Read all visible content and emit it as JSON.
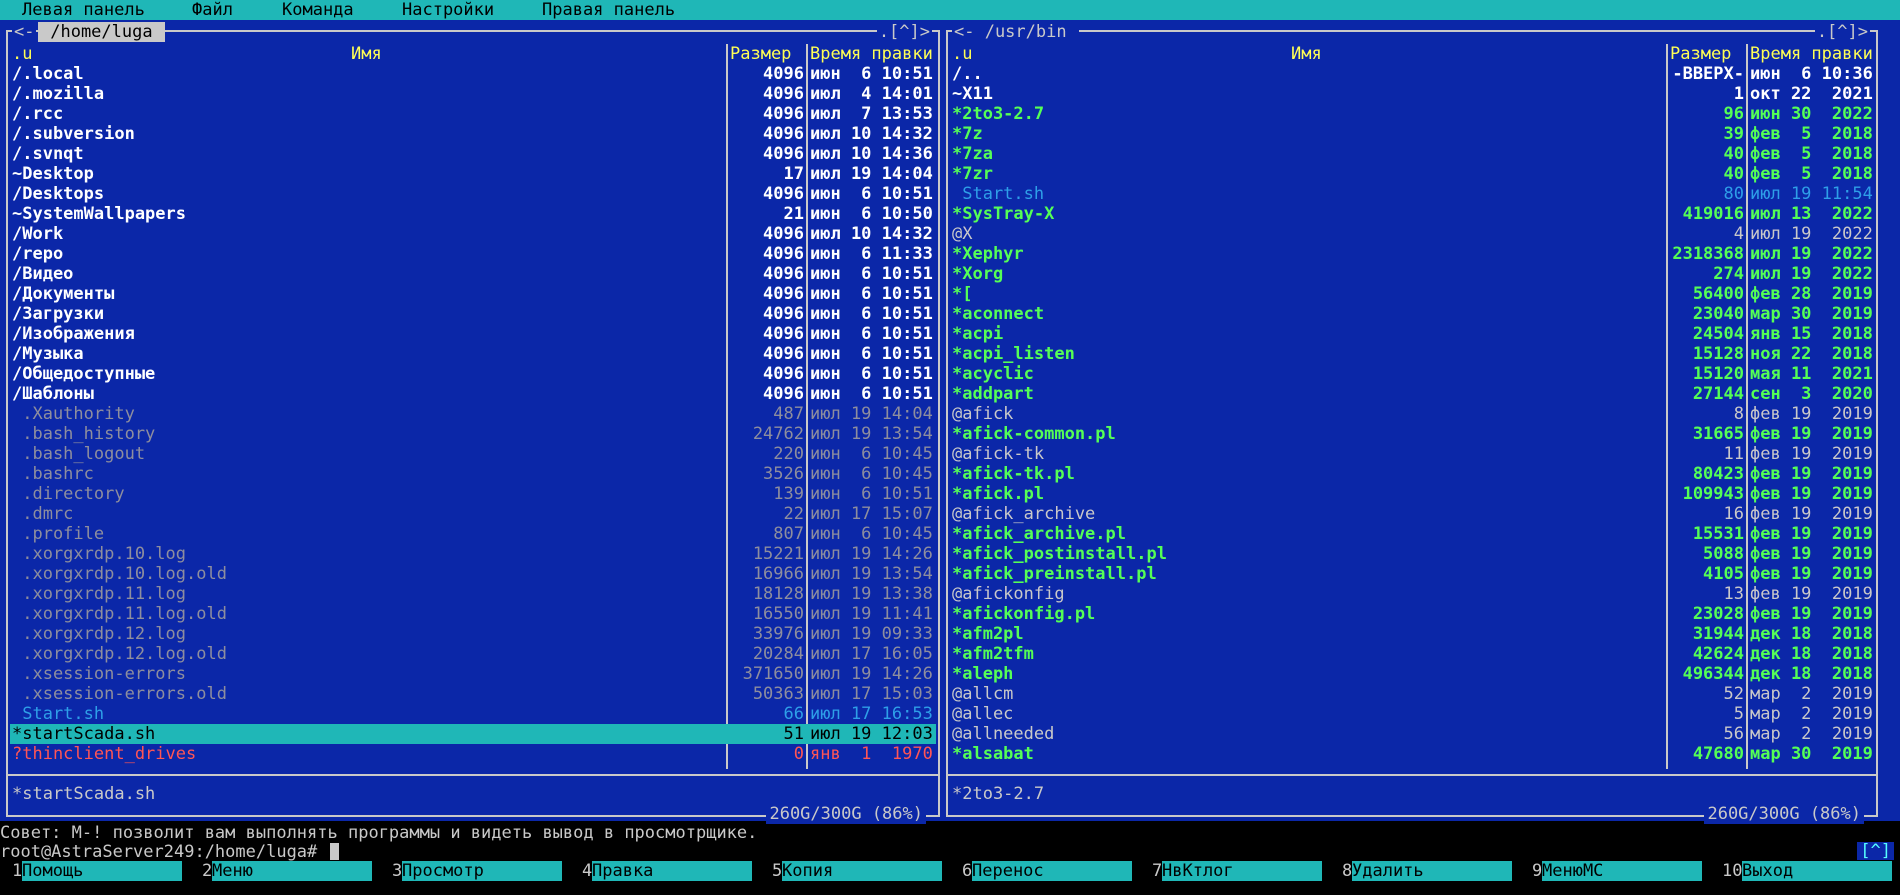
{
  "menu": [
    "Левая панель",
    "Файл",
    "Команда",
    "Настройки",
    "Правая панель"
  ],
  "colors": {
    "dir": "#ffffff",
    "hidden": "#8e8e9e",
    "exec": "#55ff55",
    "link": "#c9c9c9",
    "stalelink": "#ff5555",
    "script": "#2e9fe8",
    "selected_bg": "#1fb7b7",
    "selected_fg": "#000000"
  },
  "left": {
    "path": " /home/luga ",
    "corner": ".[^]>",
    "headers": {
      "sort": ".u",
      "name": "Имя",
      "size": "Размер",
      "time": "Время правки"
    },
    "rows": [
      {
        "name": "/.local",
        "size": "4096",
        "time": "июн  6 10:51",
        "kind": "dir"
      },
      {
        "name": "/.mozilla",
        "size": "4096",
        "time": "июл  4 14:01",
        "kind": "dir"
      },
      {
        "name": "/.rcc",
        "size": "4096",
        "time": "июл  7 13:53",
        "kind": "dir"
      },
      {
        "name": "/.subversion",
        "size": "4096",
        "time": "июл 10 14:32",
        "kind": "dir"
      },
      {
        "name": "/.svnqt",
        "size": "4096",
        "time": "июл 10 14:36",
        "kind": "dir"
      },
      {
        "name": "~Desktop",
        "size": "17",
        "time": "июл 19 14:04",
        "kind": "dir"
      },
      {
        "name": "/Desktops",
        "size": "4096",
        "time": "июн  6 10:51",
        "kind": "dir"
      },
      {
        "name": "~SystemWallpapers",
        "size": "21",
        "time": "июн  6 10:50",
        "kind": "dir"
      },
      {
        "name": "/Work",
        "size": "4096",
        "time": "июл 10 14:32",
        "kind": "dir"
      },
      {
        "name": "/repo",
        "size": "4096",
        "time": "июн  6 11:33",
        "kind": "dir"
      },
      {
        "name": "/Видео",
        "size": "4096",
        "time": "июн  6 10:51",
        "kind": "dir"
      },
      {
        "name": "/Документы",
        "size": "4096",
        "time": "июн  6 10:51",
        "kind": "dir"
      },
      {
        "name": "/Загрузки",
        "size": "4096",
        "time": "июн  6 10:51",
        "kind": "dir"
      },
      {
        "name": "/Изображения",
        "size": "4096",
        "time": "июн  6 10:51",
        "kind": "dir"
      },
      {
        "name": "/Музыка",
        "size": "4096",
        "time": "июн  6 10:51",
        "kind": "dir"
      },
      {
        "name": "/Общедоступные",
        "size": "4096",
        "time": "июн  6 10:51",
        "kind": "dir"
      },
      {
        "name": "/Шаблоны",
        "size": "4096",
        "time": "июн  6 10:51",
        "kind": "dir"
      },
      {
        "name": " .Xauthority",
        "size": "487",
        "time": "июл 19 14:04",
        "kind": "hidden"
      },
      {
        "name": " .bash_history",
        "size": "24762",
        "time": "июл 19 13:54",
        "kind": "hidden"
      },
      {
        "name": " .bash_logout",
        "size": "220",
        "time": "июн  6 10:45",
        "kind": "hidden"
      },
      {
        "name": " .bashrc",
        "size": "3526",
        "time": "июн  6 10:45",
        "kind": "hidden"
      },
      {
        "name": " .directory",
        "size": "139",
        "time": "июн  6 10:51",
        "kind": "hidden"
      },
      {
        "name": " .dmrc",
        "size": "22",
        "time": "июл 17 15:07",
        "kind": "hidden"
      },
      {
        "name": " .profile",
        "size": "807",
        "time": "июн  6 10:45",
        "kind": "hidden"
      },
      {
        "name": " .xorgxrdp.10.log",
        "size": "15221",
        "time": "июл 19 14:26",
        "kind": "hidden"
      },
      {
        "name": " .xorgxrdp.10.log.old",
        "size": "16966",
        "time": "июл 19 13:54",
        "kind": "hidden"
      },
      {
        "name": " .xorgxrdp.11.log",
        "size": "18128",
        "time": "июл 19 13:38",
        "kind": "hidden"
      },
      {
        "name": " .xorgxrdp.11.log.old",
        "size": "16550",
        "time": "июл 19 11:41",
        "kind": "hidden"
      },
      {
        "name": " .xorgxrdp.12.log",
        "size": "33976",
        "time": "июл 19 09:33",
        "kind": "hidden"
      },
      {
        "name": " .xorgxrdp.12.log.old",
        "size": "20284",
        "time": "июл 17 16:05",
        "kind": "hidden"
      },
      {
        "name": " .xsession-errors",
        "size": "371650",
        "time": "июл 19 14:26",
        "kind": "hidden"
      },
      {
        "name": " .xsession-errors.old",
        "size": "50363",
        "time": "июл 17 15:03",
        "kind": "hidden"
      },
      {
        "name": " Start.sh",
        "size": "66",
        "time": "июл 17 16:53",
        "kind": "script"
      },
      {
        "name": "*startScada.sh",
        "size": "51",
        "time": "июл 19 12:03",
        "kind": "selected"
      },
      {
        "name": "?thinclient_drives",
        "size": "0",
        "time": "янв  1  1970",
        "kind": "stalelink"
      }
    ],
    "status": "*startScada.sh",
    "disk": "260G/300G (86%)"
  },
  "right": {
    "path": "<- /usr/bin ",
    "corner": ".[^]>",
    "headers": {
      "sort": ".u",
      "name": "Имя",
      "size": "Размер",
      "time": "Время правки"
    },
    "rows": [
      {
        "name": "/..",
        "size": "-ВВЕРХ-",
        "time": "июн  6 10:36",
        "kind": "dir"
      },
      {
        "name": "~X11",
        "size": "1",
        "time": "окт 22  2021",
        "kind": "dir"
      },
      {
        "name": "*2to3-2.7",
        "size": "96",
        "time": "июн 30  2022",
        "kind": "exec"
      },
      {
        "name": "*7z",
        "size": "39",
        "time": "фев  5  2018",
        "kind": "exec"
      },
      {
        "name": "*7za",
        "size": "40",
        "time": "фев  5  2018",
        "kind": "exec"
      },
      {
        "name": "*7zr",
        "size": "40",
        "time": "фев  5  2018",
        "kind": "exec"
      },
      {
        "name": " Start.sh",
        "size": "80",
        "time": "июл 19 11:54",
        "kind": "script"
      },
      {
        "name": "*SysTray-X",
        "size": "419016",
        "time": "июл 13  2022",
        "kind": "exec"
      },
      {
        "name": "@X",
        "size": "4",
        "time": "июл 19  2022",
        "kind": "link"
      },
      {
        "name": "*Xephyr",
        "size": "2318368",
        "time": "июл 19  2022",
        "kind": "exec"
      },
      {
        "name": "*Xorg",
        "size": "274",
        "time": "июл 19  2022",
        "kind": "exec"
      },
      {
        "name": "*[",
        "size": "56400",
        "time": "фев 28  2019",
        "kind": "exec"
      },
      {
        "name": "*aconnect",
        "size": "23040",
        "time": "мар 30  2019",
        "kind": "exec"
      },
      {
        "name": "*acpi",
        "size": "24504",
        "time": "янв 15  2018",
        "kind": "exec"
      },
      {
        "name": "*acpi_listen",
        "size": "15128",
        "time": "ноя 22  2018",
        "kind": "exec"
      },
      {
        "name": "*acyclic",
        "size": "15120",
        "time": "мая 11  2021",
        "kind": "exec"
      },
      {
        "name": "*addpart",
        "size": "27144",
        "time": "сен  3  2020",
        "kind": "exec"
      },
      {
        "name": "@afick",
        "size": "8",
        "time": "фев 19  2019",
        "kind": "link"
      },
      {
        "name": "*afick-common.pl",
        "size": "31665",
        "time": "фев 19  2019",
        "kind": "exec"
      },
      {
        "name": "@afick-tk",
        "size": "11",
        "time": "фев 19  2019",
        "kind": "link"
      },
      {
        "name": "*afick-tk.pl",
        "size": "80423",
        "time": "фев 19  2019",
        "kind": "exec"
      },
      {
        "name": "*afick.pl",
        "size": "109943",
        "time": "фев 19  2019",
        "kind": "exec"
      },
      {
        "name": "@afick_archive",
        "size": "16",
        "time": "фев 19  2019",
        "kind": "link"
      },
      {
        "name": "*afick_archive.pl",
        "size": "15531",
        "time": "фев 19  2019",
        "kind": "exec"
      },
      {
        "name": "*afick_postinstall.pl",
        "size": "5088",
        "time": "фев 19  2019",
        "kind": "exec"
      },
      {
        "name": "*afick_preinstall.pl",
        "size": "4105",
        "time": "фев 19  2019",
        "kind": "exec"
      },
      {
        "name": "@afickonfig",
        "size": "13",
        "time": "фев 19  2019",
        "kind": "link"
      },
      {
        "name": "*afickonfig.pl",
        "size": "23028",
        "time": "фев 19  2019",
        "kind": "exec"
      },
      {
        "name": "*afm2pl",
        "size": "31944",
        "time": "дек 18  2018",
        "kind": "exec"
      },
      {
        "name": "*afm2tfm",
        "size": "42624",
        "time": "дек 18  2018",
        "kind": "exec"
      },
      {
        "name": "*aleph",
        "size": "496344",
        "time": "дек 18  2018",
        "kind": "exec"
      },
      {
        "name": "@allcm",
        "size": "52",
        "time": "мар  2  2019",
        "kind": "link"
      },
      {
        "name": "@allec",
        "size": "5",
        "time": "мар  2  2019",
        "kind": "link"
      },
      {
        "name": "@allneeded",
        "size": "56",
        "time": "мар  2  2019",
        "kind": "link"
      },
      {
        "name": "*alsabat",
        "size": "47680",
        "time": "мар 30  2019",
        "kind": "exec"
      }
    ],
    "status": "*2to3-2.7",
    "disk": "260G/300G (86%)"
  },
  "hint": "Совет: M-! позволит вам выполнять программы и видеть вывод в просмотрщике.",
  "prompt": "root@AstraServer249:/home/luga# ",
  "side_button": "[^]",
  "fkeys": [
    {
      "num": "1",
      "label": "Помощь"
    },
    {
      "num": "2",
      "label": "Меню"
    },
    {
      "num": "3",
      "label": "Просмотр"
    },
    {
      "num": "4",
      "label": "Правка"
    },
    {
      "num": "5",
      "label": "Копия"
    },
    {
      "num": "6",
      "label": "Перенос"
    },
    {
      "num": "7",
      "label": "НвКтлог"
    },
    {
      "num": "8",
      "label": "Удалить"
    },
    {
      "num": "9",
      "label": "МенюMC"
    },
    {
      "num": "10",
      "label": "Выход"
    }
  ]
}
